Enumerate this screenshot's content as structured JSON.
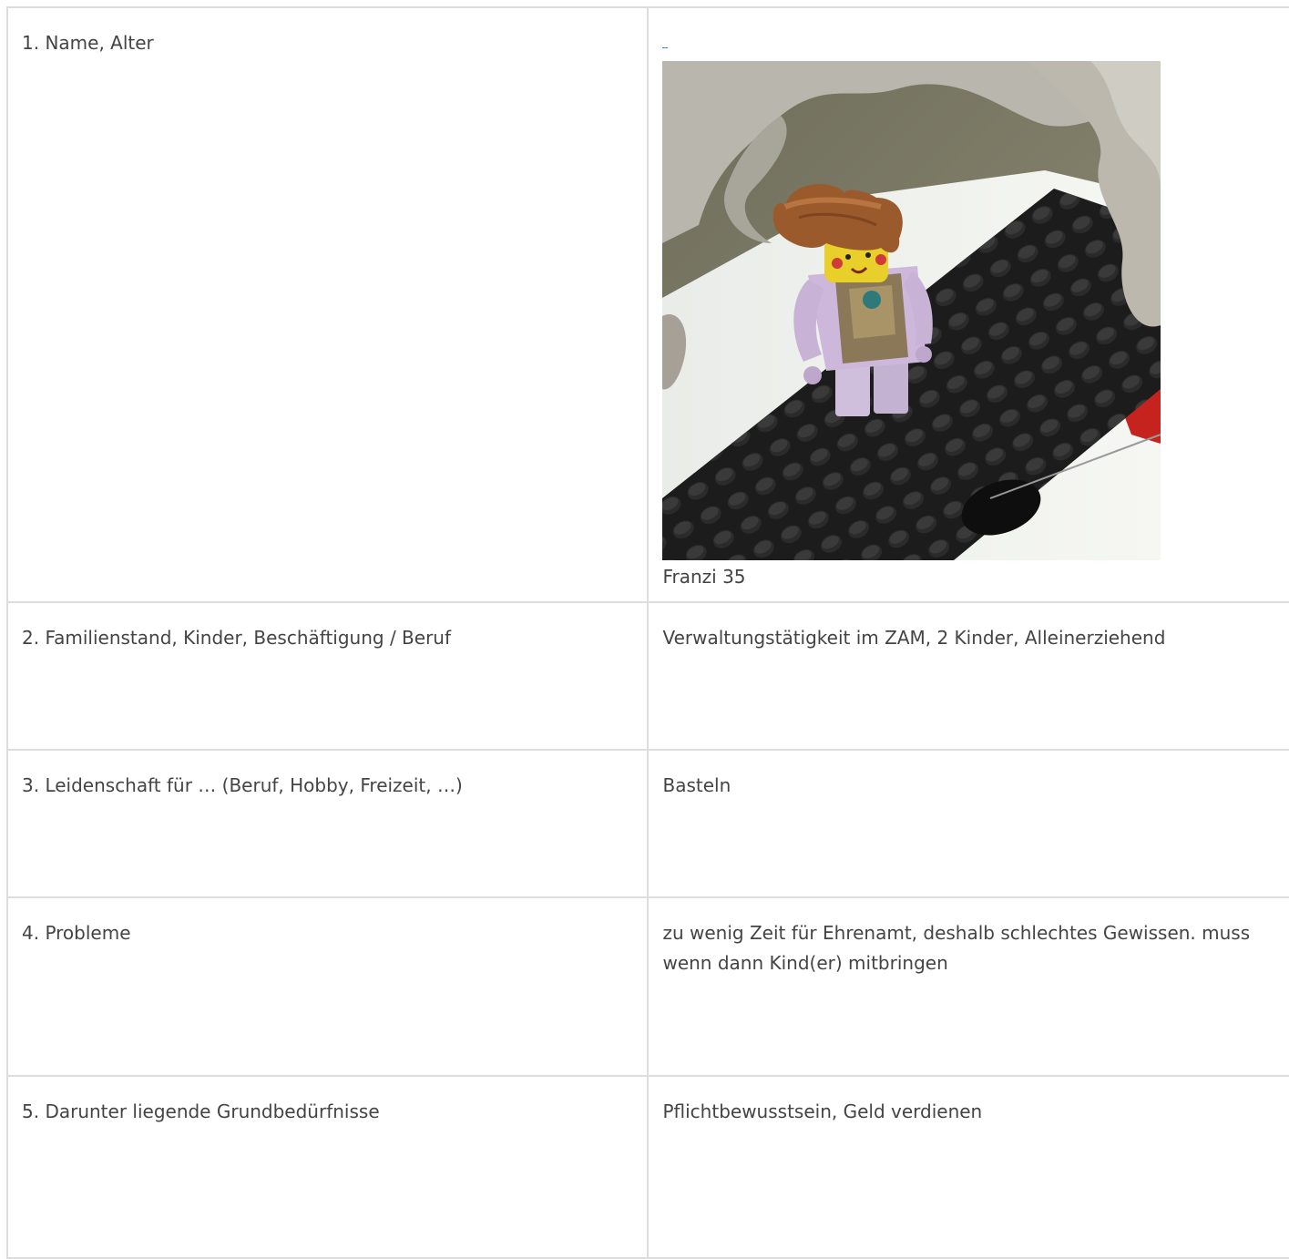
{
  "rows": [
    {
      "question": "1. Name, Alter",
      "answer": "Franzi 35"
    },
    {
      "question": "2. Familienstand, Kinder, Beschäftigung / Beruf",
      "answer": "Verwaltungstätigkeit im ZAM, 2 Kinder, Alleinerziehend"
    },
    {
      "question": "3. Leidenschaft für … (Beruf, Hobby, Freizeit, …)",
      "answer": "Basteln"
    },
    {
      "question": "4. Probleme",
      "answer": "zu wenig Zeit für Ehrenamt, deshalb schlechtes Gewissen. muss wenn dann Kind(er) mitbringen"
    },
    {
      "question": "5. Darunter liegende Grundbedürfnisse",
      "answer": "Pflichtbewusstsein, Geld verdienen"
    }
  ]
}
